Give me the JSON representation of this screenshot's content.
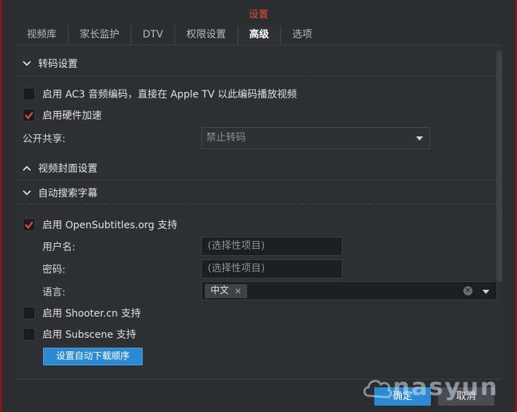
{
  "dialog": {
    "title": "设置"
  },
  "tabs": [
    {
      "label": "视频库"
    },
    {
      "label": "家长监护"
    },
    {
      "label": "DTV"
    },
    {
      "label": "权限设置"
    },
    {
      "label": "高级",
      "active": true
    },
    {
      "label": "选项"
    }
  ],
  "transcode": {
    "section_title": "转码设置",
    "ac3_label": "启用 AC3 音频编码，直接在 Apple TV 以此编码播放视频",
    "ac3_checked": false,
    "hw_label": "启用硬件加速",
    "hw_checked": true,
    "share_label": "公开共享:",
    "share_value": "禁止转码"
  },
  "cover": {
    "section_title": "视频封面设置"
  },
  "subtitles": {
    "section_title": "自动搜索字幕",
    "opensub_label": "启用 OpenSubtitles.org 支持",
    "opensub_checked": true,
    "username_label": "用户名:",
    "username_placeholder": "(选择性项目)",
    "password_label": "密码:",
    "password_placeholder": "(选择性项目)",
    "language_label": "语言:",
    "language_tag": "中文",
    "shooter_label": "启用 Shooter.cn 支持",
    "shooter_checked": false,
    "subscene_label": "启用 Subscene 支持",
    "subscene_checked": false,
    "order_button": "设置自动下载顺序"
  },
  "footer": {
    "ok": "确定",
    "cancel": "取消"
  },
  "watermark": {
    "text": "nasyun"
  },
  "colors": {
    "title": "#e5493a",
    "accent": "#2d8ad0",
    "check": "#e04a3a"
  }
}
